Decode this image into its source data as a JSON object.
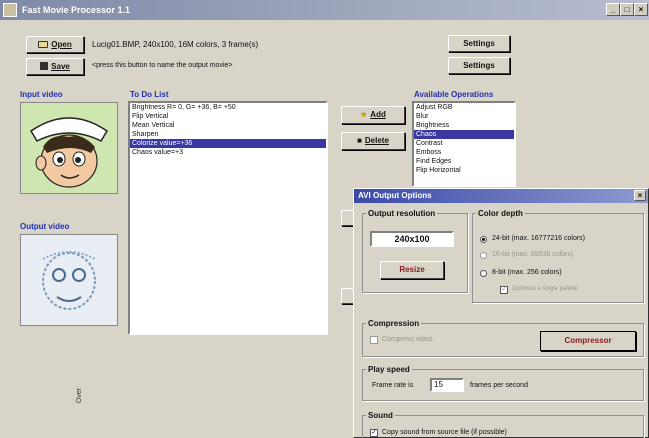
{
  "window": {
    "title": "Fast Movie Processor 1.1",
    "controls": [
      "_",
      "□",
      "×"
    ]
  },
  "toolbar": {
    "open_label": "Open",
    "save_label": "Save",
    "file_info": "Lucig01.BMP, 240x100, 16M colors, 3 frame(s)",
    "save_hint": "<press this button to name the output movie>",
    "settings_label": "Settings",
    "settings2_label": "Settings"
  },
  "input_video": {
    "label": "Input video"
  },
  "output_video": {
    "label": "Output video",
    "side_text": "Over"
  },
  "todo": {
    "label": "To Do List",
    "items": [
      "Brightness  R= 0,  G= +36,  B= +50",
      "Flip Vertical",
      "Mean Vertical",
      "Sharpen",
      "Colorize  value=+36",
      "Chaos  value=+3"
    ],
    "selected_index": 4
  },
  "actions": {
    "add_label": "Add",
    "delete_label": "Delete"
  },
  "operations": {
    "label": "Available Operations",
    "items": [
      "Adjust RGB",
      "Blur",
      "Brightness",
      "Chaos",
      "Contrast",
      "Emboss",
      "Find Edges",
      "Flip Horizontal"
    ],
    "selected_index": 3
  },
  "dialog": {
    "title": "AVI Output Options",
    "close": "×",
    "resolution": {
      "title": "Output resolution",
      "value": "240x100",
      "resize_label": "Resize"
    },
    "color_depth": {
      "title": "Color depth",
      "opt1": "24-bit  (max. 16777216 colors)",
      "opt2": "16-bit  (max. 65536 colors)",
      "opt3": "8-bit  (max. 256 colors)",
      "optimize": "Optimize a single palette"
    },
    "compression": {
      "title": "Compression",
      "checkbox": "Compress video",
      "button": "Compressor"
    },
    "play_speed": {
      "title": "Play speed",
      "prefix": "Frame rate is",
      "value": "15",
      "suffix": "frames per second"
    },
    "sound": {
      "title": "Sound",
      "checkbox": "Copy sound from source file (if possible)"
    }
  },
  "colors": {
    "accent": "#3838a0",
    "label_blue": "#2030b0",
    "face": "#d8d4c8"
  }
}
